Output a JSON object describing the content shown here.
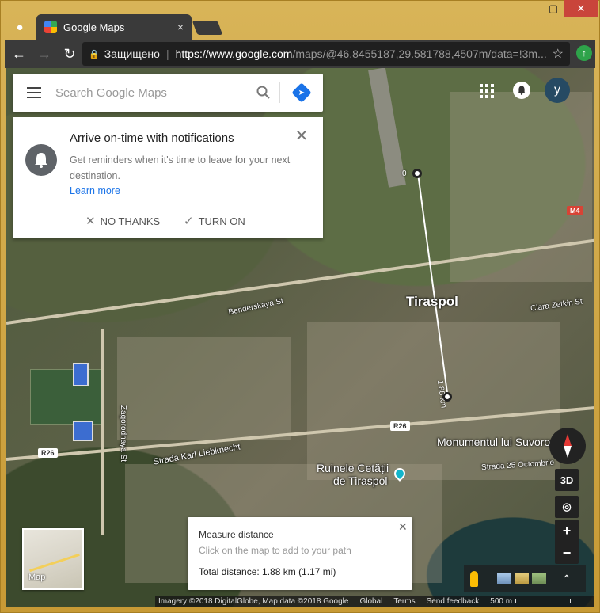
{
  "browser": {
    "tab_title": "Google Maps",
    "tab_close": "×",
    "secure_label": "Защищено",
    "url_host": "https://www.google.com",
    "url_path": "/maps/@46.8455187,29.581788,4507m/data=!3m..."
  },
  "search": {
    "placeholder": "Search Google Maps"
  },
  "notification": {
    "title": "Arrive on-time with notifications",
    "body": "Get reminders when it's time to leave for your next destination.",
    "link": "Learn more",
    "no_thanks": "NO THANKS",
    "turn_on": "TURN ON"
  },
  "account": {
    "initial": "y"
  },
  "map": {
    "city": "Tiraspol",
    "poi_1": "Monumentul lui Suvorov",
    "poi_2a": "Ruinele Cetății",
    "poi_2b": "de Tiraspol",
    "street_1": "Benderskaya St",
    "street_2": "Strada Karl Liebknecht",
    "street_3": "Clara Zetkin St",
    "street_4": "Strada 25 Octombrie",
    "street_5": "Zagorodnaya St",
    "route_r26_a": "R26",
    "route_r26_b": "R26",
    "route_m4": "M4",
    "measure_start": "0",
    "measure_end": "1.88 km"
  },
  "controls": {
    "three_d": "3D",
    "zoom_in": "+",
    "zoom_out": "−"
  },
  "minimap": {
    "label": "Map"
  },
  "measure": {
    "title": "Measure distance",
    "hint": "Click on the map to add to your path",
    "total": "Total distance: 1.88 km (1.17 mi)"
  },
  "footer": {
    "imagery": "Imagery ©2018 DigitalGlobe, Map data ©2018 Google",
    "global": "Global",
    "terms": "Terms",
    "feedback": "Send feedback",
    "scale": "500 m"
  },
  "colors": {
    "accent_blue": "#1a73e8",
    "frame_gold": "#c9a13b",
    "close_red": "#c9453b",
    "update_green": "#2ea34a"
  }
}
